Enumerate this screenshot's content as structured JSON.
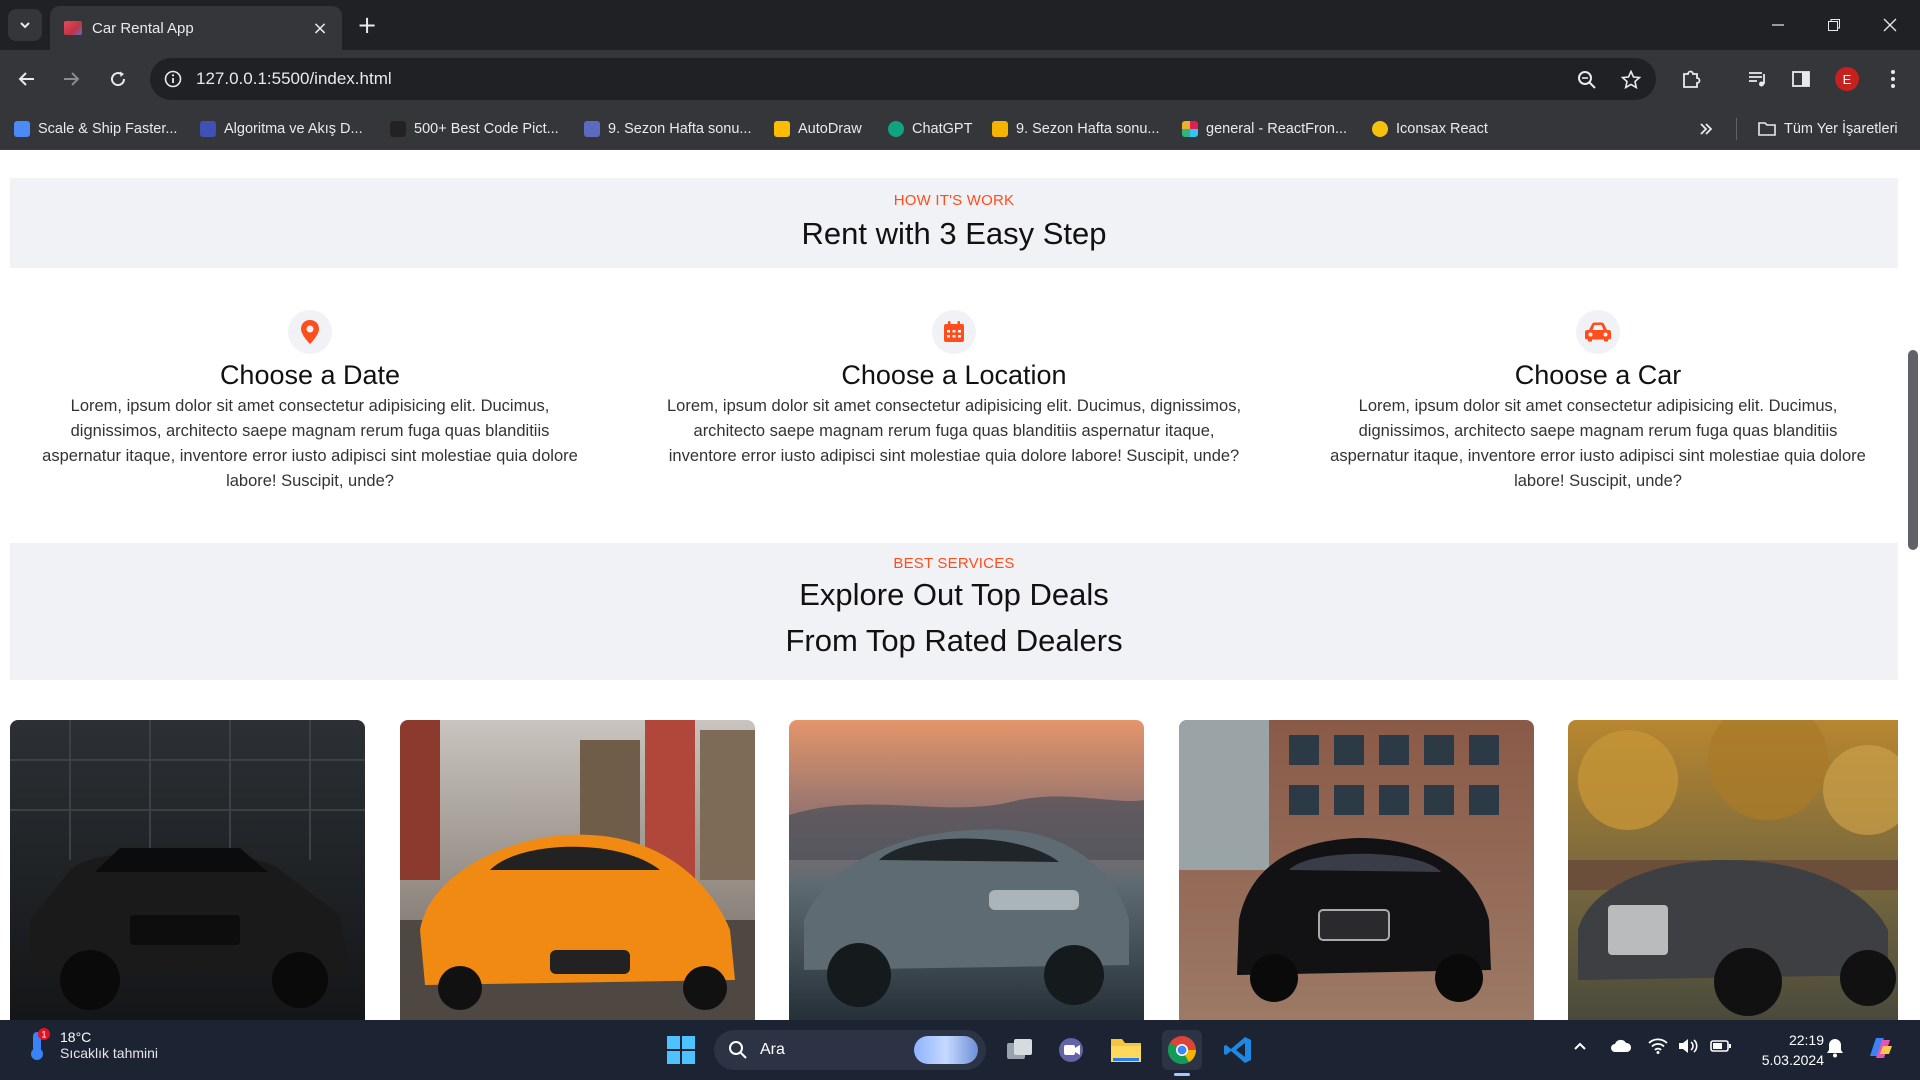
{
  "browser": {
    "tab_title": "Car Rental App",
    "url": "127.0.0.1:5500/index.html",
    "profile_initial": "E",
    "bookmarks": [
      {
        "label": "Scale & Ship Faster...",
        "icon": "scale-ship-favicon",
        "color": "#4c8bf5"
      },
      {
        "label": "Algoritma ve Akış D...",
        "icon": "algoritma-favicon",
        "color": "#3f51b5"
      },
      {
        "label": "500+ Best Code Pict...",
        "icon": "code-pict-favicon",
        "color": "#222222"
      },
      {
        "label": "9. Sezon Hafta sonu...",
        "icon": "sezon-favicon",
        "color": "#5c6bc0"
      },
      {
        "label": "AutoDraw",
        "icon": "autodraw-favicon",
        "color": "#fbbc04"
      },
      {
        "label": "ChatGPT",
        "icon": "chatgpt-favicon",
        "color": "#10a37f"
      },
      {
        "label": "9. Sezon Hafta sonu...",
        "icon": "sezon-favicon-2",
        "color": "#f4b400"
      },
      {
        "label": "general - ReactFron...",
        "icon": "slack-favicon",
        "color": "#e01e5a"
      },
      {
        "label": "Iconsax React",
        "icon": "iconsax-favicon",
        "color": "#f4c20d"
      }
    ],
    "all_bookmarks_label": "Tüm Yer İşaretleri"
  },
  "how_it_works": {
    "eyebrow": "HOW IT'S WORK",
    "title": "Rent with 3 Easy Step",
    "steps": [
      {
        "icon": "location-pin-icon",
        "title": "Choose a Date",
        "desc": "Lorem, ipsum dolor sit amet consectetur adipisicing elit. Ducimus, dignissimos, architecto saepe magnam rerum fuga quas blanditiis aspernatur itaque, inventore error iusto adipisci sint molestiae quia dolore labore! Suscipit, unde?"
      },
      {
        "icon": "calendar-icon",
        "title": "Choose a Location",
        "desc": "Lorem, ipsum dolor sit amet consectetur adipisicing elit. Ducimus, dignissimos, architecto saepe magnam rerum fuga quas blanditiis aspernatur itaque, inventore error iusto adipisci sint molestiae quia dolore labore! Suscipit, unde?"
      },
      {
        "icon": "car-icon",
        "title": "Choose a Car",
        "desc": "Lorem, ipsum dolor sit amet consectetur adipisicing elit. Ducimus, dignissimos, architecto saepe magnam rerum fuga quas blanditiis aspernatur itaque, inventore error iusto adipisci sint molestiae quia dolore labore! Suscipit, unde?"
      }
    ]
  },
  "services": {
    "eyebrow": "BEST SERVICES",
    "title_line1": "Explore Out Top Deals",
    "title_line2": "From Top Rated Dealers",
    "cars": [
      {
        "name": "black-hatchback",
        "body": "#1a1a1a",
        "bg_top": "#2c3034",
        "bg_bottom": "#141618"
      },
      {
        "name": "orange-sports-car",
        "body": "#f08a12",
        "bg_top": "#c9c4bf",
        "bg_bottom": "#6b6158"
      },
      {
        "name": "grey-coupe",
        "body": "#5f6b72",
        "bg_top": "#e4956a",
        "bg_bottom": "#263038"
      },
      {
        "name": "black-sedan",
        "body": "#121214",
        "bg_top": "#8a5a48",
        "bg_bottom": "#9c7a66"
      },
      {
        "name": "grey-convertible",
        "body": "#3d3f42",
        "bg_top": "#b8862f",
        "bg_bottom": "#4a4a3c"
      }
    ]
  },
  "accent_color": "#ff4d1c",
  "taskbar": {
    "temperature": "18°C",
    "weather_desc": "Sıcaklık tahmini",
    "weather_badge": "1",
    "search_label": "Ara",
    "time": "22:19",
    "date": "5.03.2024"
  }
}
